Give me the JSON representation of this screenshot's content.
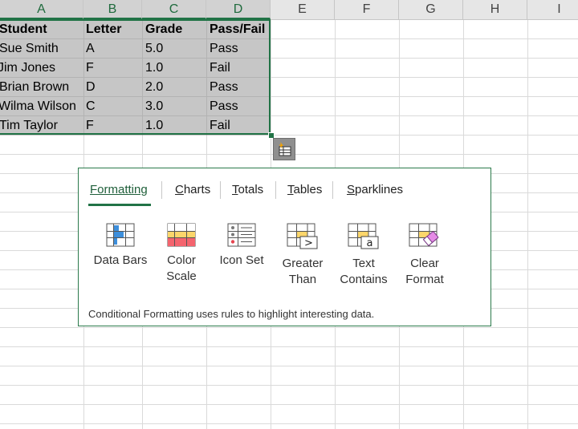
{
  "columns": [
    "A",
    "B",
    "C",
    "D",
    "E",
    "F",
    "G",
    "H",
    "I"
  ],
  "table": {
    "headers": [
      "Student",
      "Letter",
      "Grade",
      "Pass/Fail"
    ],
    "rows": [
      [
        "Sue Smith",
        "A",
        "5.0",
        "Pass"
      ],
      [
        "Jim Jones",
        "F",
        "1.0",
        "Fail"
      ],
      [
        "Brian Brown",
        "D",
        "2.0",
        "Pass"
      ],
      [
        "Wilma Wilson",
        "C",
        "3.0",
        "Pass"
      ],
      [
        "Tim Taylor",
        "F",
        "1.0",
        "Fail"
      ]
    ]
  },
  "quick_analysis": {
    "button_icon": "quick-analysis-icon",
    "tabs": [
      {
        "pre": "",
        "u": "Formatting",
        "post": ""
      },
      {
        "pre": "",
        "u": "C",
        "post": "harts"
      },
      {
        "pre": "",
        "u": "T",
        "post": "otals"
      },
      {
        "pre": "",
        "u": "T",
        "post": "ables"
      },
      {
        "pre": "",
        "u": "S",
        "post": "parklines"
      }
    ],
    "options": [
      {
        "line1": "Data Bars",
        "line2": "",
        "icon": "data-bars-icon"
      },
      {
        "line1": "Color",
        "line2": "Scale",
        "icon": "color-scale-icon"
      },
      {
        "line1": "Icon Set",
        "line2": "",
        "icon": "icon-set-icon"
      },
      {
        "line1": "Greater",
        "line2": "Than",
        "icon": "greater-than-icon"
      },
      {
        "line1": "Text",
        "line2": "Contains",
        "icon": "text-contains-icon"
      },
      {
        "line1": "Clear",
        "line2": "Format",
        "icon": "clear-format-icon"
      }
    ],
    "description": "Conditional Formatting uses rules to highlight interesting data."
  },
  "colors": {
    "accent": "#217346",
    "selection": "#c6c6c6"
  }
}
